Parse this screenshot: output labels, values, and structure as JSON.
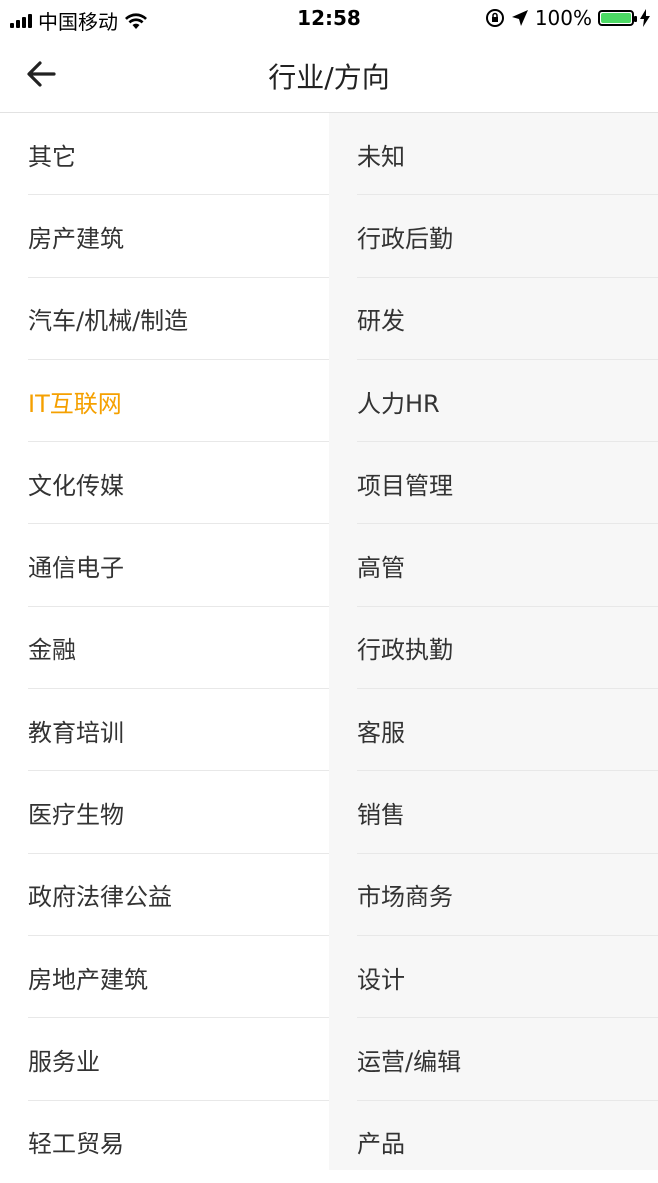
{
  "status_bar": {
    "carrier": "中国移动",
    "time": "12:58",
    "battery": "100%"
  },
  "nav": {
    "title": "行业/方向"
  },
  "colors": {
    "active": "#f5a000",
    "right_column_bg": "#f7f7f7",
    "battery_fill": "#4cd964"
  },
  "industries": [
    {
      "label": "其它"
    },
    {
      "label": "房产建筑"
    },
    {
      "label": "汽车/机械/制造"
    },
    {
      "label": "IT互联网",
      "selected": true
    },
    {
      "label": "文化传媒"
    },
    {
      "label": "通信电子"
    },
    {
      "label": "金融"
    },
    {
      "label": "教育培训"
    },
    {
      "label": "医疗生物"
    },
    {
      "label": "政府法律公益"
    },
    {
      "label": "房地产建筑"
    },
    {
      "label": "服务业"
    },
    {
      "label": "轻工贸易"
    }
  ],
  "directions": [
    {
      "label": "未知"
    },
    {
      "label": "行政后勤"
    },
    {
      "label": "研发"
    },
    {
      "label": "人力HR"
    },
    {
      "label": "项目管理"
    },
    {
      "label": "高管"
    },
    {
      "label": "行政执勤"
    },
    {
      "label": "客服"
    },
    {
      "label": "销售"
    },
    {
      "label": "市场商务"
    },
    {
      "label": "设计"
    },
    {
      "label": "运营/编辑"
    },
    {
      "label": "产品"
    }
  ]
}
